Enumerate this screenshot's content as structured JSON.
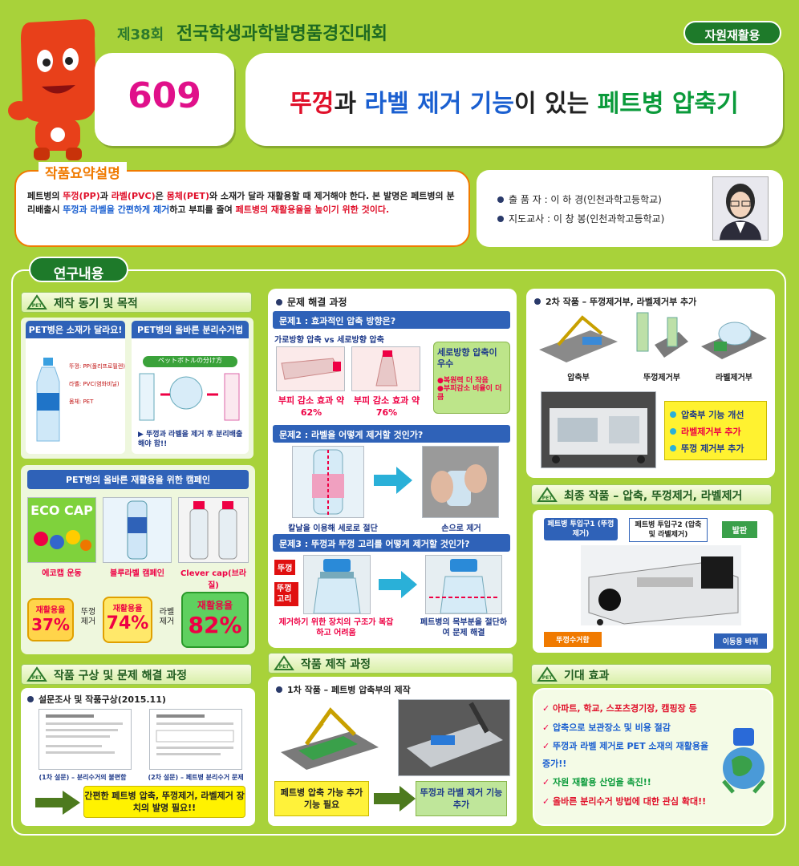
{
  "header": {
    "session": "제38회",
    "contest": "전국학생과학발명품경진대회",
    "category": "자원재활용",
    "number": "609",
    "title_parts": [
      "뚜껑",
      "과 ",
      "라벨 제거 기능",
      "이 있는 ",
      "페트병 압축기"
    ]
  },
  "summary": {
    "heading": "작품요약설명",
    "text_parts": [
      "페트병의 ",
      "뚜껑(PP)",
      "과 ",
      "라벨(PVC)",
      "은 ",
      "몸체(PET)",
      "와 소재가 달라 ",
      "재활용할 때 제거해야 한다. 본 발명은 페트병의 분리배출시 ",
      "뚜껑과 라벨을 간편하게 제거",
      "하고 부피를 줄여 ",
      "페트병의 재활용율을 높이기 위한 것이다."
    ]
  },
  "author": {
    "line1": "출 품 자 : 이 하 경(인천과학고등학교)",
    "line2": "지도교사 : 이 창 봉(인천과학고등학교)"
  },
  "research_heading": "연구내용",
  "motive": {
    "heading": "제작 동기 및 목적",
    "box1_title": "PET병은 소재가 달라요!",
    "box2_title": "PET병의 올바른 분리수거법",
    "labels": [
      "뚜껑: PP(폴리프로필렌)",
      "라벨: PVC(염화비닐)",
      "몸체: PET"
    ],
    "jp_sign": "ペットボトルの分け方",
    "box2_caption": "뚜껑과 라벨을 제거 후 분리배출해야 함!!"
  },
  "campaign": {
    "title": "PET병의 올바른 재활용을 위한 캠페인",
    "eco": "ECO CAP",
    "captions": [
      "에코캡 운동",
      "블루라벨 캠페인",
      "Clever cap(브라질)"
    ],
    "rate_label": "재활용율",
    "rates": [
      "37%",
      "74%",
      "82%"
    ],
    "steps": [
      "뚜껑 제거",
      "라벨 제거"
    ]
  },
  "design": {
    "heading": "작품 구상 및 문제 해결 과정",
    "survey": "설문조사 및 작품구상(2015.11)",
    "cap1": "(1차 설문) – 분리수거의 불편함",
    "cap2": "(2차 설문) – 페트병 분리수거 문제",
    "conclusion": "간편한 페트병 압축, 뚜껑제거, 라벨제거 장치의 발명 필요!!"
  },
  "process": {
    "heading": "문제 해결 과정",
    "q1": "문제1 : 효과적인 압축 방향은?",
    "q1_compare": "가로방향 압축  vs  세로방향 압축",
    "r1a": "부피 감소 효과 약 62%",
    "r1b": "부피 감소 효과 약 76%",
    "r1_title": "세로방향 압축이 우수",
    "r1_p1": "●복원력 더 작음",
    "r1_p2": "●부피감소 비율이 더 큼",
    "q2": "문제2 : 라벨을 어떻게 제거할 것인가?",
    "r2a": "칼날을 이용해 세로로 절단",
    "r2b": "손으로 제거",
    "q3": "문제3 : 뚜껑과 뚜껑 고리를 어떻게 제거할 것인가?",
    "tag1": "뚜껑",
    "tag2": "뚜껑 고리",
    "r3a": "제거하기 위한 장치의 구조가 복잡하고 어려움",
    "r3b": "페트병의 목부분을 절단하여 문제 해결"
  },
  "making": {
    "heading": "작품 제작 과정",
    "first": "1차 작품 – 페트병 압축부의 제작",
    "box1": "페트병 압축 가능 추가 기능 필요",
    "box2": "뚜껑과 라벨 제거 기능 추가"
  },
  "second": {
    "heading": "2차 작품 – 뚜껑제거부, 라벨제거부 추가",
    "captions": [
      "압축부",
      "뚜껑제거부",
      "라벨제거부"
    ],
    "list": [
      "압축부 기능 개선",
      "라벨제거부 추가",
      "뚜껑 제거부 추가"
    ]
  },
  "final": {
    "heading": "최종 작품 – 압축, 뚜껑제거, 라벨제거",
    "tags": [
      "페트병 투입구1 (뚜껑제거)",
      "페트병 투입구2 (압축 및 라벨제거)",
      "발판",
      "뚜껑수거함",
      "이동용 바퀴"
    ]
  },
  "effect": {
    "heading": "기대 효과",
    "items": [
      "아파트, 학교, 스포츠경기장, 캠핑장 등",
      "압축으로 보관장소 및 비용 절감",
      "뚜껑과 라벨 제거로 PET 소재의 재활용율 증가!!",
      "자원 재활용 산업을 촉진!!",
      "올바른 분리수거 방법에 대한 관심 확대!!"
    ]
  },
  "colors": {
    "bg": "#a8d23a",
    "accent": "#e0102a",
    "blue": "#1a5fd0",
    "green": "#0a9a3a"
  }
}
